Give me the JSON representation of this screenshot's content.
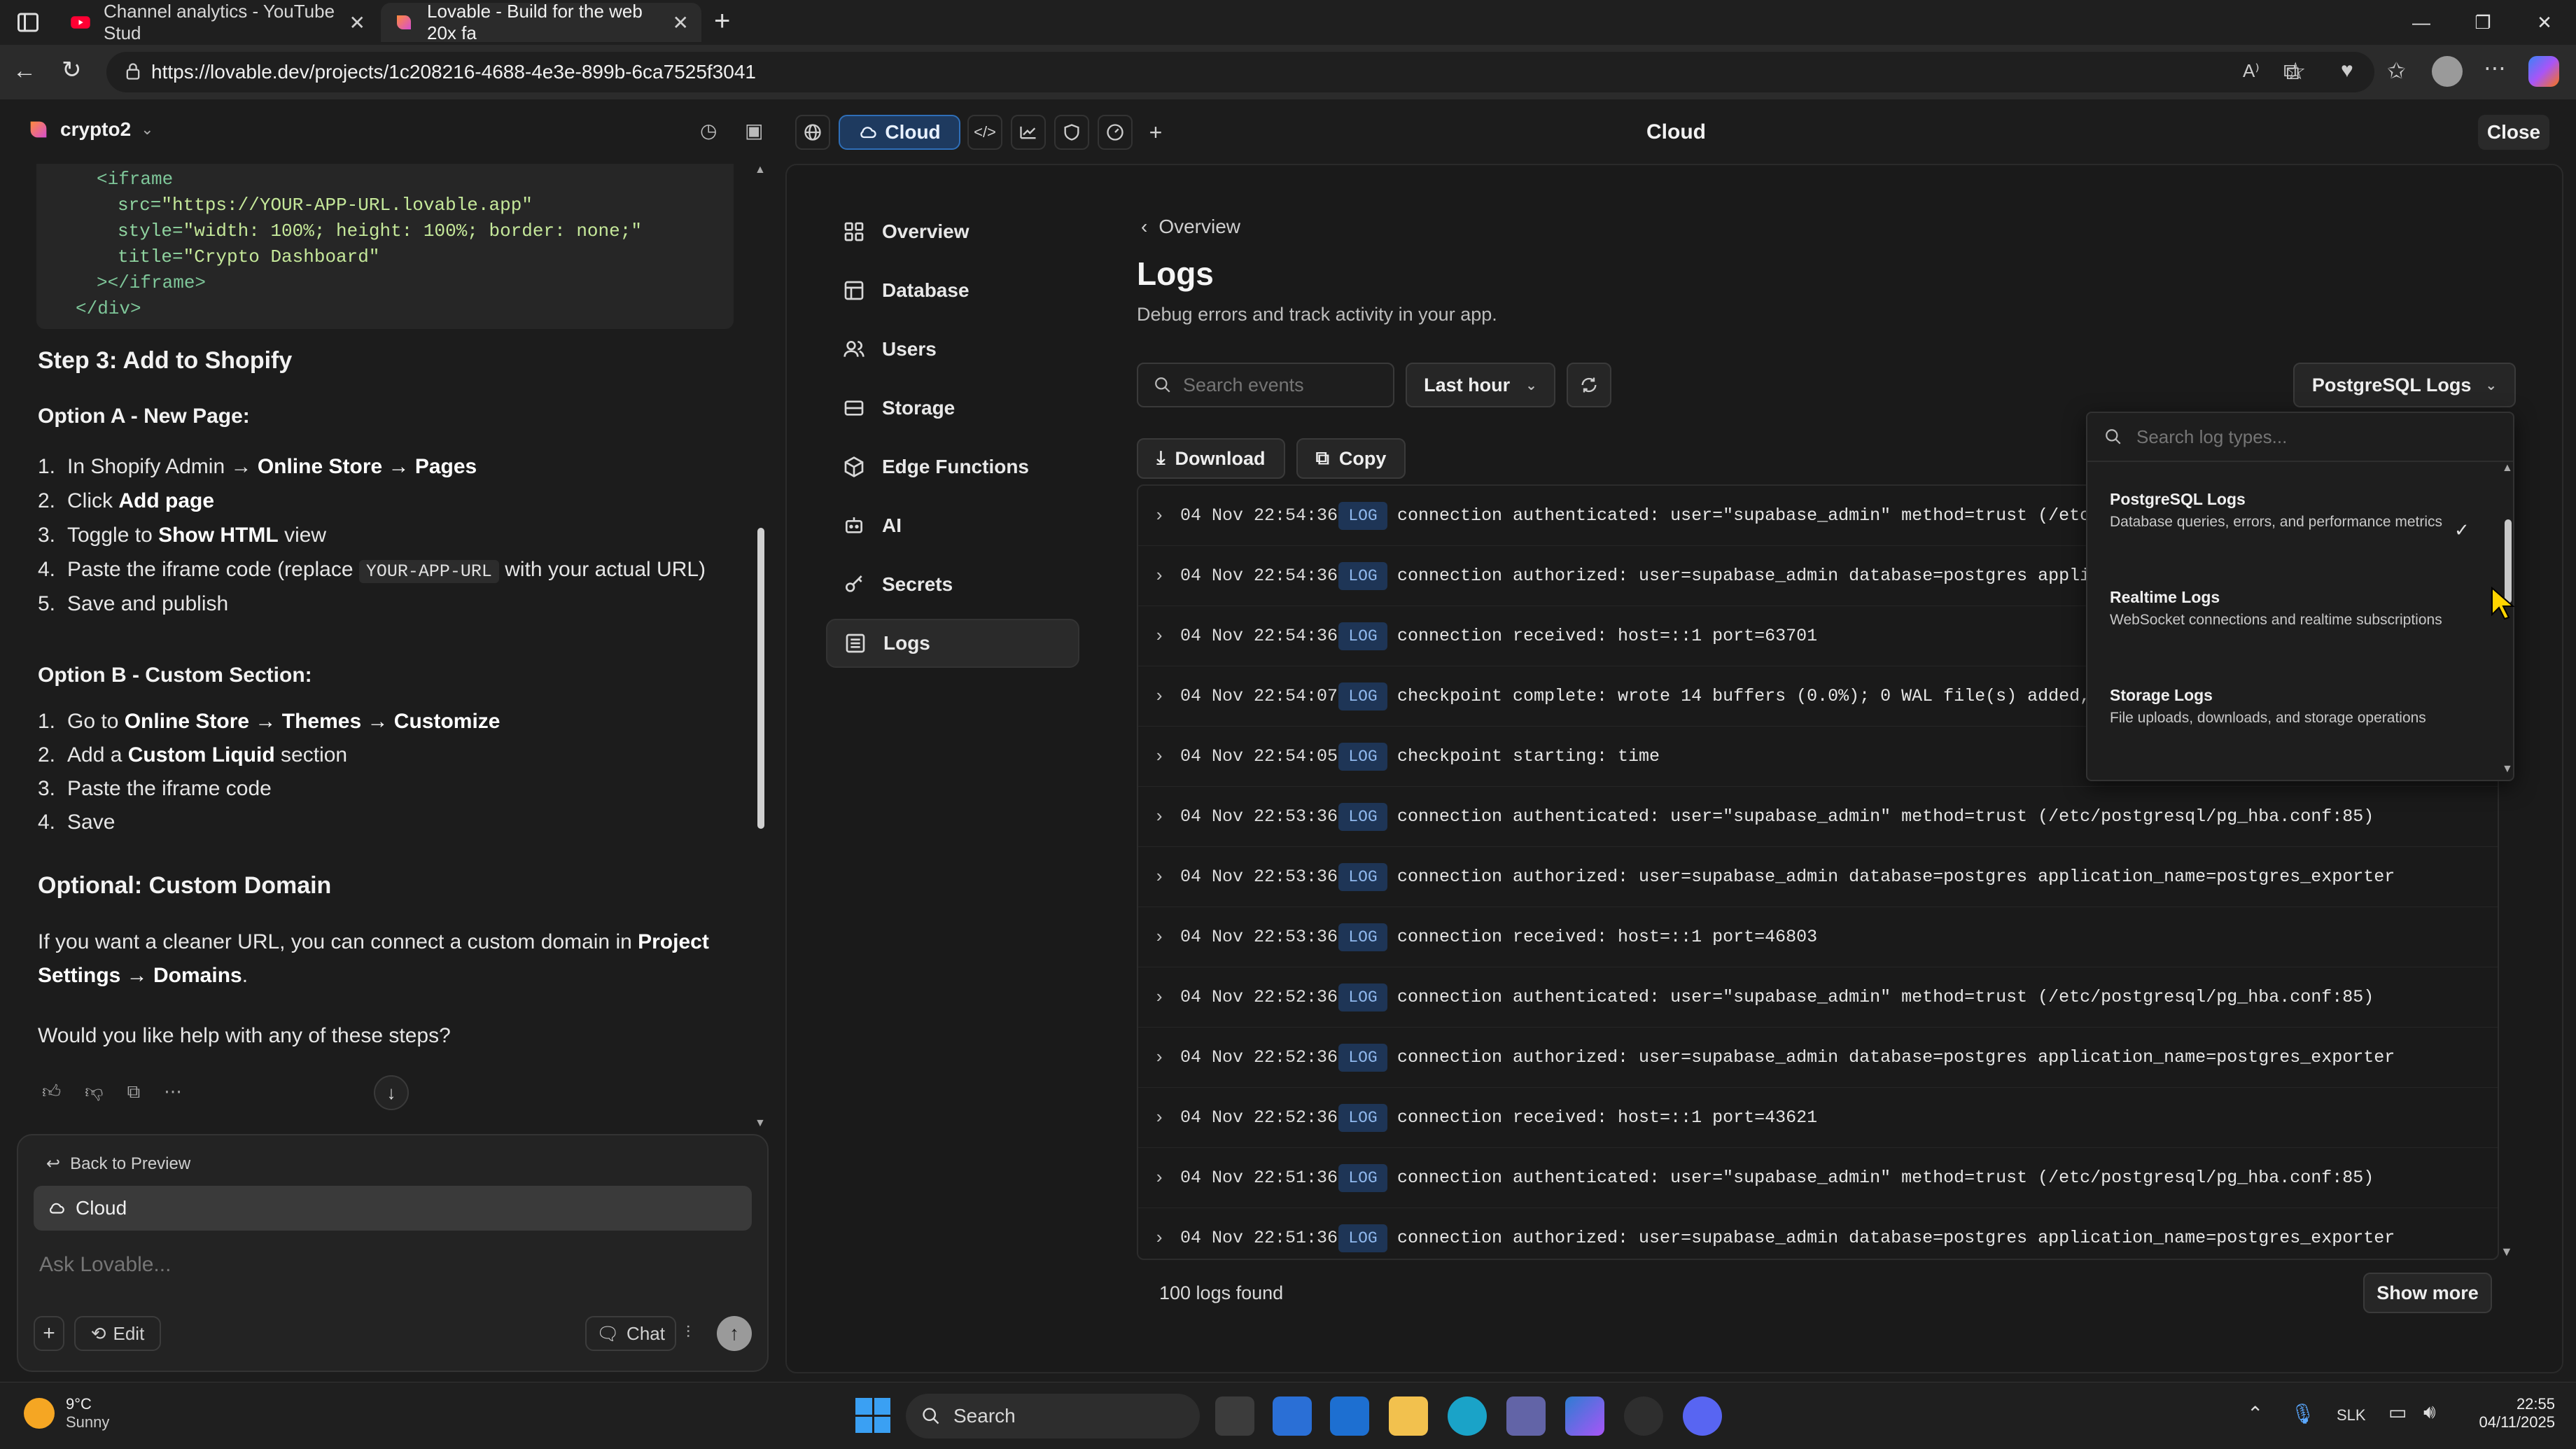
{
  "browser": {
    "tabs": [
      {
        "title": "Channel analytics - YouTube Stud",
        "active": false
      },
      {
        "title": "Lovable - Build for the web 20x fa",
        "active": true
      }
    ],
    "url": "https://lovable.dev/projects/1c208216-4688-4e3e-899b-6ca7525f3041"
  },
  "header": {
    "project_name": "crypto2",
    "cloud_label": "Cloud",
    "title": "Cloud",
    "close_label": "Close"
  },
  "chat": {
    "code_lines": [
      {
        "indent": 1,
        "parts": [
          [
            "tag",
            "<iframe"
          ]
        ]
      },
      {
        "indent": 2,
        "parts": [
          [
            "attr",
            "src="
          ],
          [
            "str",
            "\"https://YOUR-APP-URL.lovable.app\""
          ]
        ]
      },
      {
        "indent": 2,
        "parts": [
          [
            "attr",
            "style="
          ],
          [
            "str",
            "\"width: 100%; height: 100%; border: none;\""
          ]
        ]
      },
      {
        "indent": 2,
        "parts": [
          [
            "attr",
            "title="
          ],
          [
            "str",
            "\"Crypto Dashboard\""
          ]
        ]
      },
      {
        "indent": 1,
        "parts": [
          [
            "tag",
            "></iframe>"
          ]
        ]
      },
      {
        "indent": 0,
        "parts": [
          [
            "tag",
            "</div>"
          ]
        ]
      }
    ],
    "step3_heading": "Step 3: Add to Shopify",
    "optionA_heading": "Option A - New Page:",
    "optionA_items": [
      [
        "1.",
        "In Shopify Admin → ",
        "b:Online Store → Pages"
      ],
      [
        "2.",
        "Click ",
        "b:Add page"
      ],
      [
        "3.",
        "Toggle to ",
        "b:Show HTML",
        " view"
      ],
      [
        "4.",
        "Paste the iframe code (replace ",
        "c:YOUR-APP-URL",
        " with your actual URL)"
      ],
      [
        "5.",
        "Save and publish"
      ]
    ],
    "optionB_heading": "Option B - Custom Section:",
    "optionB_items": [
      [
        "1.",
        "Go to ",
        "b:Online Store → Themes → Customize"
      ],
      [
        "2.",
        "Add a ",
        "b:Custom Liquid",
        " section"
      ],
      [
        "3.",
        "Paste the iframe code"
      ],
      [
        "4.",
        "Save"
      ]
    ],
    "optional_heading": "Optional: Custom Domain",
    "domain_para_1": "If you want a cleaner URL, you can connect a custom domain in ",
    "domain_para_bold_1": "Project",
    "domain_para_bold_2": "Settings → Domains",
    "domain_para_end": ".",
    "followup": "Would you like help with any of these steps?",
    "back_to_preview": "Back to Preview",
    "cloud_chip": "Cloud",
    "input_placeholder": "Ask Lovable...",
    "edit_label": "Edit",
    "chat_label": "Chat"
  },
  "sidebar": {
    "items": [
      {
        "label": "Overview",
        "icon": "grid-icon"
      },
      {
        "label": "Database",
        "icon": "table-icon"
      },
      {
        "label": "Users",
        "icon": "users-icon"
      },
      {
        "label": "Storage",
        "icon": "storage-icon"
      },
      {
        "label": "Edge Functions",
        "icon": "box-icon"
      },
      {
        "label": "AI",
        "icon": "robot-icon"
      },
      {
        "label": "Secrets",
        "icon": "key-icon"
      },
      {
        "label": "Logs",
        "icon": "list-icon",
        "active": true
      }
    ]
  },
  "logs": {
    "breadcrumb": "Overview",
    "title": "Logs",
    "description": "Debug errors and track activity in your app.",
    "search_placeholder": "Search events",
    "time_range": "Last hour",
    "log_source": "PostgreSQL Logs",
    "download_label": "Download",
    "copy_label": "Copy",
    "rows": [
      {
        "ts": "04 Nov 22:54:36",
        "level": "LOG",
        "msg": "connection authenticated: user=\"supabase_admin\" method=trust (/etc/postgresql/pg_hba.conf:85)"
      },
      {
        "ts": "04 Nov 22:54:36",
        "level": "LOG",
        "msg": "connection authorized: user=supabase_admin database=postgres application_name=postgres_exporter"
      },
      {
        "ts": "04 Nov 22:54:36",
        "level": "LOG",
        "msg": "connection received: host=::1 port=63701"
      },
      {
        "ts": "04 Nov 22:54:07",
        "level": "LOG",
        "msg": "checkpoint complete: wrote 14 buffers (0.0%); 0 WAL file(s) added, 0 removed"
      },
      {
        "ts": "04 Nov 22:54:05",
        "level": "LOG",
        "msg": "checkpoint starting: time"
      },
      {
        "ts": "04 Nov 22:53:36",
        "level": "LOG",
        "msg": "connection authenticated: user=\"supabase_admin\" method=trust (/etc/postgresql/pg_hba.conf:85)"
      },
      {
        "ts": "04 Nov 22:53:36",
        "level": "LOG",
        "msg": "connection authorized: user=supabase_admin database=postgres application_name=postgres_exporter"
      },
      {
        "ts": "04 Nov 22:53:36",
        "level": "LOG",
        "msg": "connection received: host=::1 port=46803"
      },
      {
        "ts": "04 Nov 22:52:36",
        "level": "LOG",
        "msg": "connection authenticated: user=\"supabase_admin\" method=trust (/etc/postgresql/pg_hba.conf:85)"
      },
      {
        "ts": "04 Nov 22:52:36",
        "level": "LOG",
        "msg": "connection authorized: user=supabase_admin database=postgres application_name=postgres_exporter"
      },
      {
        "ts": "04 Nov 22:52:36",
        "level": "LOG",
        "msg": "connection received: host=::1 port=43621"
      },
      {
        "ts": "04 Nov 22:51:36",
        "level": "LOG",
        "msg": "connection authenticated: user=\"supabase_admin\" method=trust (/etc/postgresql/pg_hba.conf:85)"
      },
      {
        "ts": "04 Nov 22:51:36",
        "level": "LOG",
        "msg": "connection authorized: user=supabase_admin database=postgres application_name=postgres_exporter"
      }
    ],
    "count_text": "100 logs found",
    "show_more_label": "Show more"
  },
  "dropdown": {
    "search_placeholder": "Search log types...",
    "options": [
      {
        "title": "PostgreSQL Logs",
        "desc": "Database queries, errors, and performance metrics",
        "selected": true
      },
      {
        "title": "Realtime Logs",
        "desc": "WebSocket connections and realtime subscriptions",
        "selected": false
      },
      {
        "title": "Storage Logs",
        "desc": "File uploads, downloads, and storage operations",
        "selected": false
      }
    ]
  },
  "taskbar": {
    "weather_temp": "9°C",
    "weather_cond": "Sunny",
    "search_label": "Search",
    "lang": "SLK",
    "time": "22:55",
    "date": "04/11/2025"
  }
}
